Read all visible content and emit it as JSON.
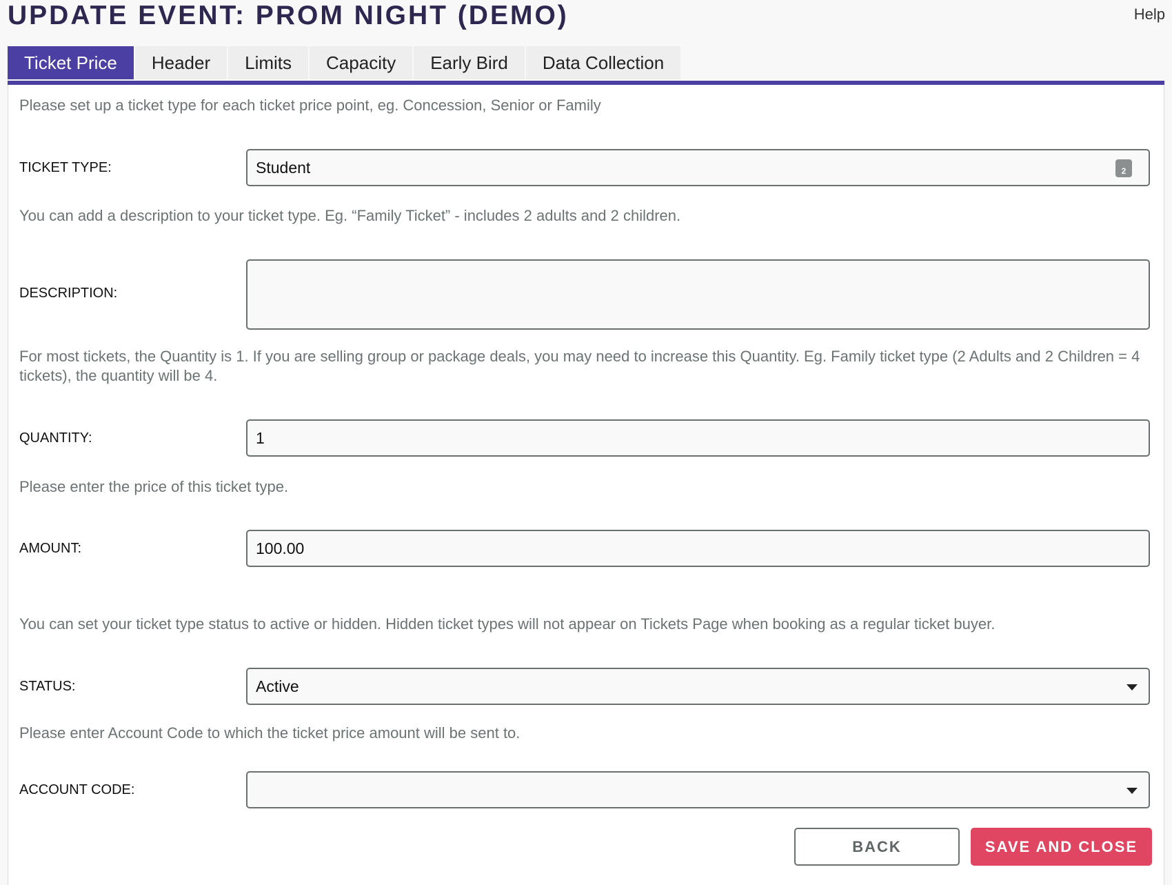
{
  "header": {
    "title": "UPDATE EVENT: PROM NIGHT (DEMO)",
    "help": "Help"
  },
  "tabs": [
    {
      "label": "Ticket Price",
      "active": true
    },
    {
      "label": "Header"
    },
    {
      "label": "Limits"
    },
    {
      "label": "Capacity"
    },
    {
      "label": "Early Bird"
    },
    {
      "label": "Data Collection"
    }
  ],
  "colors": {
    "accent": "#4b3fa3",
    "save": "#e04562"
  },
  "form": {
    "intro": "Please set up a ticket type for each ticket price point, eg. Concession, Senior or Family",
    "ticket_type": {
      "label": "TICKET TYPE:",
      "value": "Student",
      "icon": "keyboard-autofill-icon"
    },
    "description_help": "You can add a description to your ticket type. Eg. “Family Ticket” - includes 2 adults and 2 children.",
    "description": {
      "label": "DESCRIPTION:",
      "value": ""
    },
    "quantity_help": "For most tickets, the Quantity is 1. If you are selling group or package deals, you may need to increase this Quantity. Eg. Family ticket type (2 Adults and 2 Children = 4 tickets), the quantity will be 4.",
    "quantity": {
      "label": "QUANTITY:",
      "value": "1"
    },
    "amount_help": "Please enter the price of this ticket type.",
    "amount": {
      "label": "AMOUNT:",
      "value": "100.00"
    },
    "status_help": "You can set your ticket type status to active or hidden. Hidden ticket types will not appear on Tickets Page when booking as a regular ticket buyer.",
    "status": {
      "label": "STATUS:",
      "value": "Active"
    },
    "account_help": "Please enter Account Code to which the ticket price amount will be sent to.",
    "account_code": {
      "label": "ACCOUNT CODE:",
      "value": ""
    }
  },
  "actions": {
    "back": "BACK",
    "save": "SAVE AND CLOSE"
  }
}
